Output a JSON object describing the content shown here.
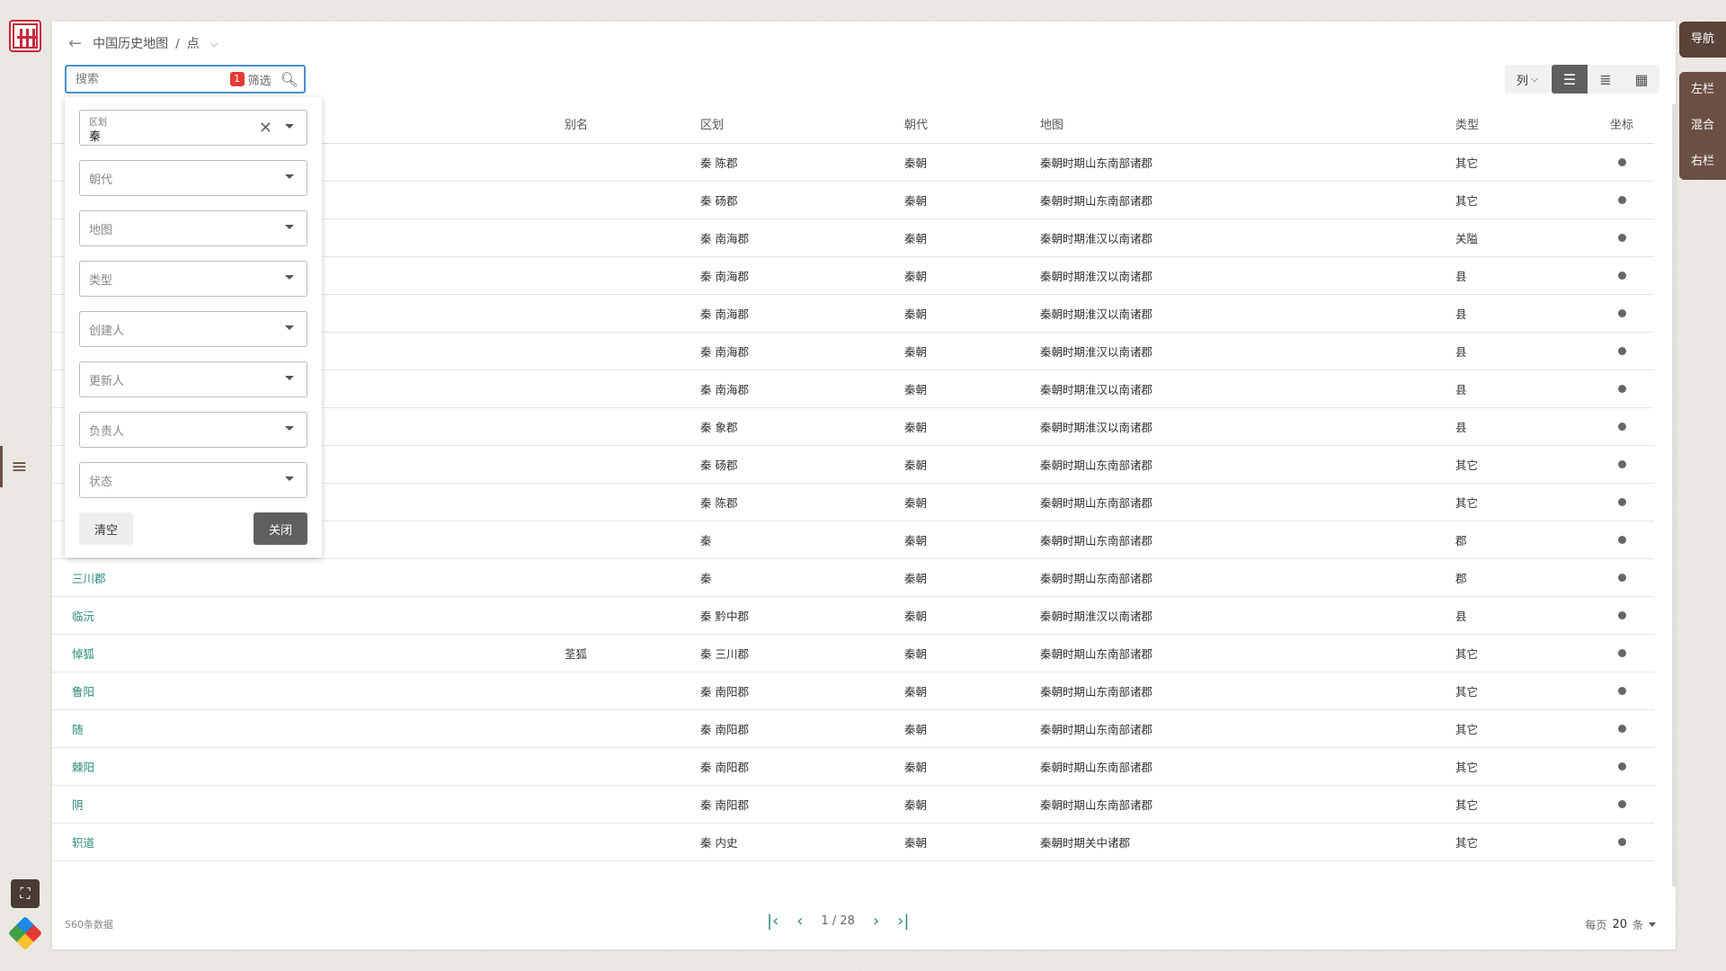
{
  "breadcrumb": {
    "root": "中国历史地图",
    "current": "点"
  },
  "search": {
    "placeholder": "搜索",
    "filter_count": "1",
    "filter_label": "筛选"
  },
  "toolbar": {
    "columns_label": "列"
  },
  "right_tabs": {
    "nav": "导航",
    "left": "左栏",
    "mixed": "混合",
    "right": "右栏"
  },
  "filters": {
    "region_label": "区划",
    "region_value": "秦",
    "dynasty": "朝代",
    "map": "地图",
    "type": "类型",
    "creator": "创建人",
    "updater": "更新人",
    "owner": "负责人",
    "status": "状态",
    "clear": "清空",
    "close": "关闭"
  },
  "table": {
    "headers": {
      "alias": "别名",
      "region": "区划",
      "dynasty": "朝代",
      "map": "地图",
      "type": "类型",
      "coord": "坐标"
    },
    "rows": [
      {
        "name": "",
        "alias": "",
        "region": "秦 陈郡",
        "dynasty": "秦朝",
        "map": "秦朝时期山东南部诸郡",
        "type": "其它"
      },
      {
        "name": "",
        "alias": "",
        "region": "秦 砀郡",
        "dynasty": "秦朝",
        "map": "秦朝时期山东南部诸郡",
        "type": "其它"
      },
      {
        "name": "",
        "alias": "",
        "region": "秦 南海郡",
        "dynasty": "秦朝",
        "map": "秦朝时期淮汉以南诸郡",
        "type": "关隘"
      },
      {
        "name": "",
        "alias": "",
        "region": "秦 南海郡",
        "dynasty": "秦朝",
        "map": "秦朝时期淮汉以南诸郡",
        "type": "县"
      },
      {
        "name": "",
        "alias": "",
        "region": "秦 南海郡",
        "dynasty": "秦朝",
        "map": "秦朝时期淮汉以南诸郡",
        "type": "县"
      },
      {
        "name": "",
        "alias": "",
        "region": "秦 南海郡",
        "dynasty": "秦朝",
        "map": "秦朝时期淮汉以南诸郡",
        "type": "县"
      },
      {
        "name": "",
        "alias": "",
        "region": "秦 南海郡",
        "dynasty": "秦朝",
        "map": "秦朝时期淮汉以南诸郡",
        "type": "县"
      },
      {
        "name": "",
        "alias": "",
        "region": "秦 象郡",
        "dynasty": "秦朝",
        "map": "秦朝时期淮汉以南诸郡",
        "type": "县"
      },
      {
        "name": "",
        "alias": "",
        "region": "秦 砀郡",
        "dynasty": "秦朝",
        "map": "秦朝时期山东南部诸郡",
        "type": "其它"
      },
      {
        "name": "",
        "alias": "",
        "region": "秦 陈郡",
        "dynasty": "秦朝",
        "map": "秦朝时期山东南部诸郡",
        "type": "其它"
      },
      {
        "name": "",
        "alias": "",
        "region": "秦",
        "dynasty": "秦朝",
        "map": "秦朝时期山东南部诸郡",
        "type": "郡"
      },
      {
        "name": "三川郡",
        "alias": "",
        "region": "秦",
        "dynasty": "秦朝",
        "map": "秦朝时期山东南部诸郡",
        "type": "郡"
      },
      {
        "name": "临沅",
        "alias": "",
        "region": "秦 黔中郡",
        "dynasty": "秦朝",
        "map": "秦朝时期淮汉以南诸郡",
        "type": "县"
      },
      {
        "name": "悼狐",
        "alias": "荃狐",
        "region": "秦 三川郡",
        "dynasty": "秦朝",
        "map": "秦朝时期山东南部诸郡",
        "type": "其它"
      },
      {
        "name": "鲁阳",
        "alias": "",
        "region": "秦 南阳郡",
        "dynasty": "秦朝",
        "map": "秦朝时期山东南部诸郡",
        "type": "其它"
      },
      {
        "name": "随",
        "alias": "",
        "region": "秦 南阳郡",
        "dynasty": "秦朝",
        "map": "秦朝时期山东南部诸郡",
        "type": "其它"
      },
      {
        "name": "棘阳",
        "alias": "",
        "region": "秦 南阳郡",
        "dynasty": "秦朝",
        "map": "秦朝时期山东南部诸郡",
        "type": "其它"
      },
      {
        "name": "阴",
        "alias": "",
        "region": "秦 南阳郡",
        "dynasty": "秦朝",
        "map": "秦朝时期山东南部诸郡",
        "type": "其它"
      },
      {
        "name": "轵道",
        "alias": "",
        "region": "秦 内史",
        "dynasty": "秦朝",
        "map": "秦朝时期关中诸郡",
        "type": "其它"
      }
    ]
  },
  "footer": {
    "count": "560条数据",
    "page": "1 / 28",
    "per_page_label": "每页",
    "per_page": "20",
    "per_page_unit": "条"
  },
  "colors": {
    "accent": "#2b8a7a",
    "brown": "#6b4f43",
    "focus": "#4b8fd1",
    "badge": "#e53935"
  }
}
